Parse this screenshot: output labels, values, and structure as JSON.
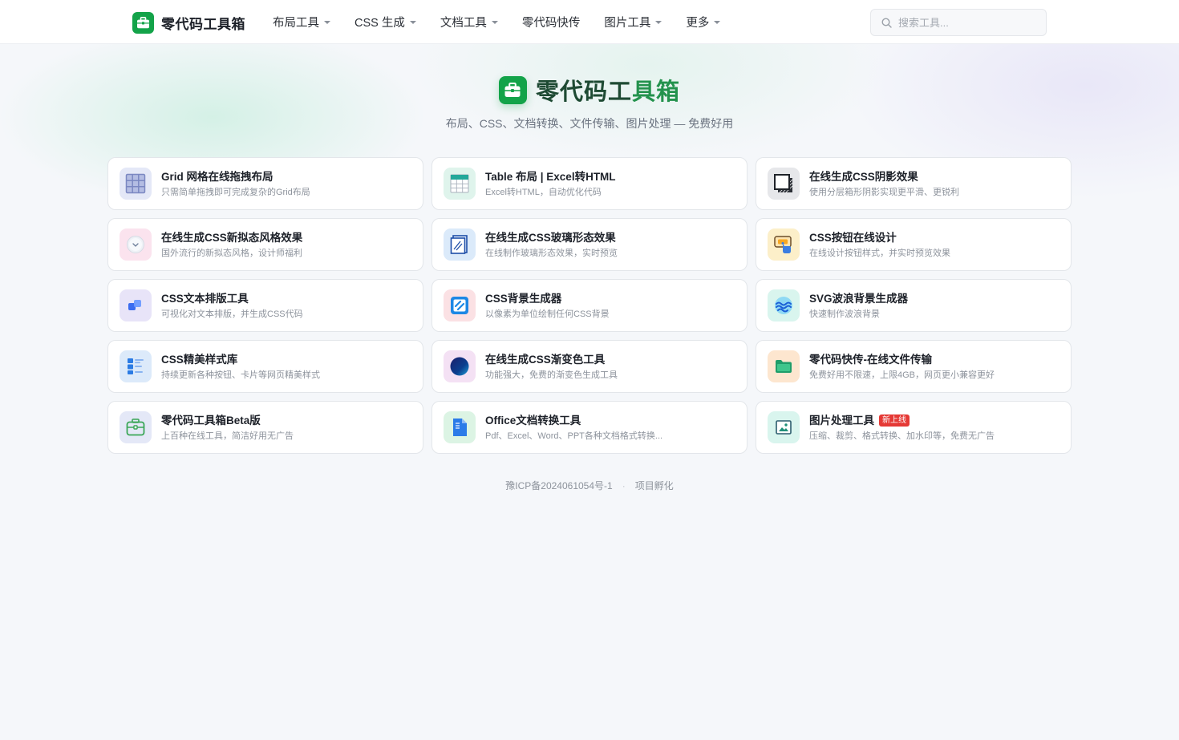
{
  "header": {
    "brand": "零代码工具箱",
    "nav": [
      {
        "label": "布局工具",
        "dropdown": true
      },
      {
        "label": "CSS 生成",
        "dropdown": true
      },
      {
        "label": "文档工具",
        "dropdown": true
      },
      {
        "label": "零代码快传",
        "dropdown": false
      },
      {
        "label": "图片工具",
        "dropdown": true
      },
      {
        "label": "更多",
        "dropdown": true
      }
    ],
    "search_placeholder": "搜索工具..."
  },
  "hero": {
    "title_main": "零代码工",
    "title_tail": "具箱",
    "subtitle": "布局、CSS、文档转换、文件传输、图片处理 — 免费好用"
  },
  "tools": [
    {
      "title": "Grid 网格在线拖拽布局",
      "desc": "只需简单拖拽即可完成复杂的Grid布局",
      "icon": "grid-icon",
      "bg": "#e4e8f7"
    },
    {
      "title": "Table 布局 | Excel转HTML",
      "desc": "Excel转HTML，自动优化代码",
      "icon": "table-icon",
      "bg": "#dff4ec"
    },
    {
      "title": "在线生成CSS阴影效果",
      "desc": "使用分层箱形阴影实现更平滑、更锐利",
      "icon": "shadow-icon",
      "bg": "#e6e7ea"
    },
    {
      "title": "在线生成CSS新拟态风格效果",
      "desc": "国外流行的新拟态风格，设计师福利",
      "icon": "neumorphism-icon",
      "bg": "#fbe3ee"
    },
    {
      "title": "在线生成CSS玻璃形态效果",
      "desc": "在线制作玻璃形态效果，实时预览",
      "icon": "glass-icon",
      "bg": "#dbeafa"
    },
    {
      "title": "CSS按钮在线设计",
      "desc": "在线设计按钮样式，并实时预览效果",
      "icon": "button-icon",
      "bg": "#fcefc9"
    },
    {
      "title": "CSS文本排版工具",
      "desc": "可视化对文本排版，并生成CSS代码",
      "icon": "text-layout-icon",
      "bg": "#e8e4f8"
    },
    {
      "title": "CSS背景生成器",
      "desc": "以像素为单位绘制任何CSS背景",
      "icon": "background-icon",
      "bg": "#fbe1e4"
    },
    {
      "title": "SVG波浪背景生成器",
      "desc": "快速制作波浪背景",
      "icon": "wave-icon",
      "bg": "#d9f5ee"
    },
    {
      "title": "CSS精美样式库",
      "desc": "持续更新各种按钮、卡片等网页精美样式",
      "icon": "style-library-icon",
      "bg": "#dceafa"
    },
    {
      "title": "在线生成CSS渐变色工具",
      "desc": "功能强大，免费的渐变色生成工具",
      "icon": "gradient-icon",
      "bg": "#f4e1f4"
    },
    {
      "title": "零代码快传-在线文件传输",
      "desc": "免费好用不限速，上限4GB，网页更小兼容更好",
      "icon": "folder-icon",
      "bg": "#fde6cf"
    },
    {
      "title": "零代码工具箱Beta版",
      "desc": "上百种在线工具，简洁好用无广告",
      "icon": "toolbox-icon",
      "bg": "#e4e8f7"
    },
    {
      "title": "Office文档转换工具",
      "desc": "Pdf、Excel、Word、PPT各种文档格式转换...",
      "icon": "document-icon",
      "bg": "#dcf4e4"
    },
    {
      "title": "图片处理工具",
      "desc": "压缩、裁剪、格式转换、加水印等，免费无广告",
      "icon": "image-icon",
      "bg": "#d9f5ee",
      "badge": "新上线"
    }
  ],
  "footer": {
    "icp": "豫ICP备2024061054号-1",
    "sep": "·",
    "incubation": "项目孵化"
  }
}
